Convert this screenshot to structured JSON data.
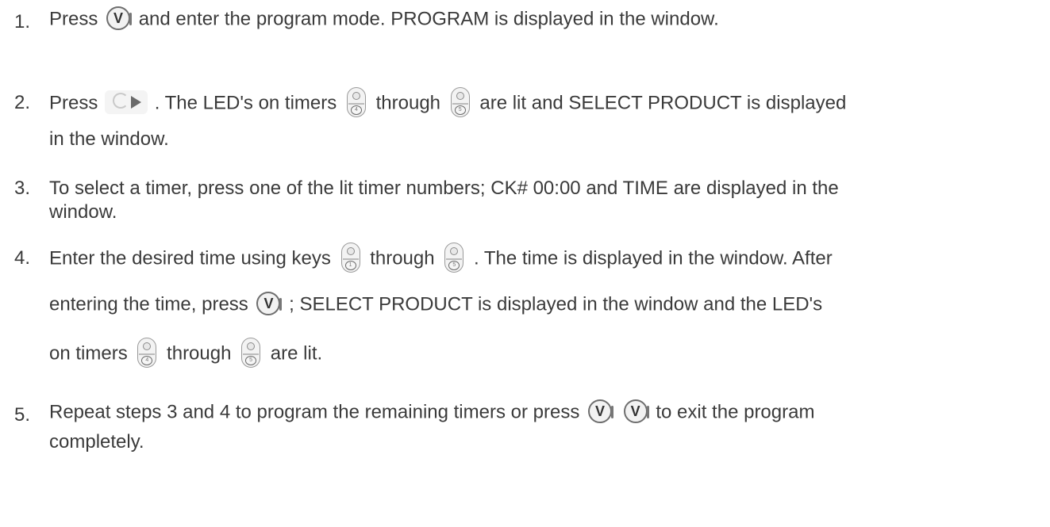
{
  "steps": [
    {
      "number": "1.",
      "lines": [
        {
          "t1": "Press",
          "t2": "and enter the program mode. PROGRAM is displayed in the window."
        }
      ]
    },
    {
      "number": "2.",
      "lines": [
        {
          "t1": "Press",
          "t2": ". The LED's on timers",
          "t3": "through",
          "t4": "are lit and SELECT PRODUCT is displayed"
        },
        {
          "t1": "in the window."
        }
      ]
    },
    {
      "number": "3.",
      "lines": [
        {
          "t1": "To select a timer, press one of the lit timer numbers; CK# 00:00 and TIME are displayed in the"
        },
        {
          "t1": "window."
        }
      ]
    },
    {
      "number": "4.",
      "lines": [
        {
          "t1": "Enter the desired time using keys",
          "t2": "through",
          "t3": ". The time is displayed in the window. After"
        },
        {
          "t1": "entering the time, press",
          "t2": "; SELECT PRODUCT is displayed in the window and the LED's"
        },
        {
          "t1": "on timers",
          "t2": "through",
          "t3": "are lit."
        }
      ]
    },
    {
      "number": "5.",
      "lines": [
        {
          "t1": "Repeat steps 3 and 4 to program the remaining timers or press",
          "t2": "to exit the program"
        },
        {
          "t1": "completely."
        }
      ]
    }
  ],
  "icons": {
    "v_key_letter": "V",
    "timer_first": "4",
    "timer_last": "5",
    "timer_one": "1"
  }
}
